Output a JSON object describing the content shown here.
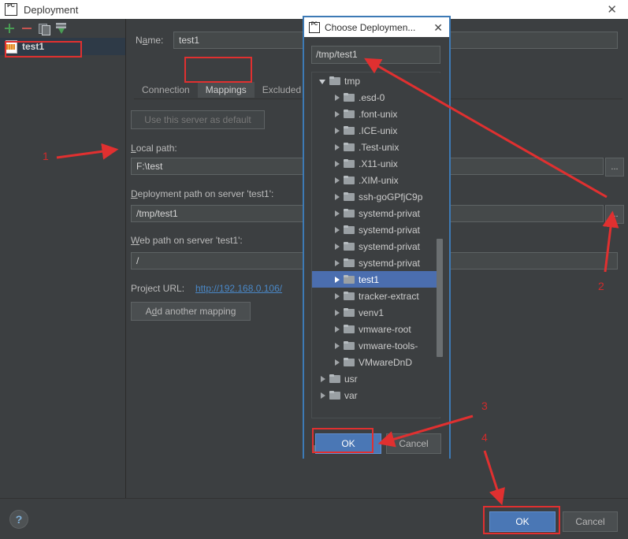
{
  "window": {
    "title": "Deployment",
    "app_icon": "pycharm-logo-icon",
    "close_label": "✕"
  },
  "left_panel": {
    "toolbar": [
      {
        "name": "add-server-button",
        "icon": "plus-icon",
        "label": "+"
      },
      {
        "name": "remove-server-button",
        "icon": "minus-icon",
        "label": "−"
      },
      {
        "name": "copy-server-button",
        "icon": "copy-icon",
        "label": "Copy"
      },
      {
        "name": "import-server-button",
        "icon": "import-icon",
        "label": "Import"
      }
    ],
    "servers": [
      {
        "name": "test1",
        "icon": "server-config-icon",
        "selected": true
      }
    ]
  },
  "main": {
    "name_label": "Name:",
    "name_value": "test1",
    "tabs": [
      {
        "label": "Connection",
        "active": false
      },
      {
        "label": "Mappings",
        "active": true
      },
      {
        "label": "Excluded Pa",
        "active": false
      }
    ],
    "use_default_button": "Use this server as default",
    "local_path_label": "Local path:",
    "local_path_value": "F:\\test",
    "deployment_path_label": "Deployment path on server 'test1':",
    "deployment_path_value": "/tmp/test1",
    "web_path_label": "Web path on server 'test1':",
    "web_path_value": "/",
    "project_url_label": "Project URL:",
    "project_url_value": "http://192.168.0.106/",
    "add_mapping_button": "Add another mapping",
    "browse_button_label": "..."
  },
  "bottom": {
    "help_label": "?",
    "ok_label": "OK",
    "cancel_label": "Cancel"
  },
  "dialog": {
    "app_icon": "pycharm-logo-icon",
    "title": "Choose Deploymen...",
    "close_label": "✕",
    "path_value": "/tmp/test1",
    "ok_label": "OK",
    "cancel_label": "Cancel",
    "tree": [
      {
        "label": "tmp",
        "depth": 0,
        "expanded": true,
        "selected": false
      },
      {
        "label": ".esd-0",
        "depth": 1,
        "expanded": false,
        "selected": false
      },
      {
        "label": ".font-unix",
        "depth": 1,
        "expanded": false,
        "selected": false
      },
      {
        "label": ".ICE-unix",
        "depth": 1,
        "expanded": false,
        "selected": false
      },
      {
        "label": ".Test-unix",
        "depth": 1,
        "expanded": false,
        "selected": false
      },
      {
        "label": ".X11-unix",
        "depth": 1,
        "expanded": false,
        "selected": false
      },
      {
        "label": ".XIM-unix",
        "depth": 1,
        "expanded": false,
        "selected": false
      },
      {
        "label": "ssh-goGPfjC9p",
        "depth": 1,
        "expanded": false,
        "selected": false
      },
      {
        "label": "systemd-privat",
        "depth": 1,
        "expanded": false,
        "selected": false
      },
      {
        "label": "systemd-privat",
        "depth": 1,
        "expanded": false,
        "selected": false
      },
      {
        "label": "systemd-privat",
        "depth": 1,
        "expanded": false,
        "selected": false
      },
      {
        "label": "systemd-privat",
        "depth": 1,
        "expanded": false,
        "selected": false
      },
      {
        "label": "test1",
        "depth": 1,
        "expanded": false,
        "selected": true
      },
      {
        "label": "tracker-extract",
        "depth": 1,
        "expanded": false,
        "selected": false
      },
      {
        "label": "venv1",
        "depth": 1,
        "expanded": false,
        "selected": false
      },
      {
        "label": "vmware-root",
        "depth": 1,
        "expanded": false,
        "selected": false
      },
      {
        "label": "vmware-tools-",
        "depth": 1,
        "expanded": false,
        "selected": false
      },
      {
        "label": "VMwareDnD",
        "depth": 1,
        "expanded": false,
        "selected": false
      },
      {
        "label": "usr",
        "depth": 0,
        "expanded": false,
        "selected": false
      },
      {
        "label": "var",
        "depth": 0,
        "expanded": false,
        "selected": false
      }
    ]
  },
  "annotations": {
    "accent_color": "#e03030",
    "steps": [
      {
        "number": "1",
        "target": "local-path-field"
      },
      {
        "number": "2",
        "target": "deployment-path-browse-button"
      },
      {
        "number": "3",
        "target": "dialog-ok-button"
      },
      {
        "number": "4",
        "target": "main-ok-button"
      }
    ]
  }
}
